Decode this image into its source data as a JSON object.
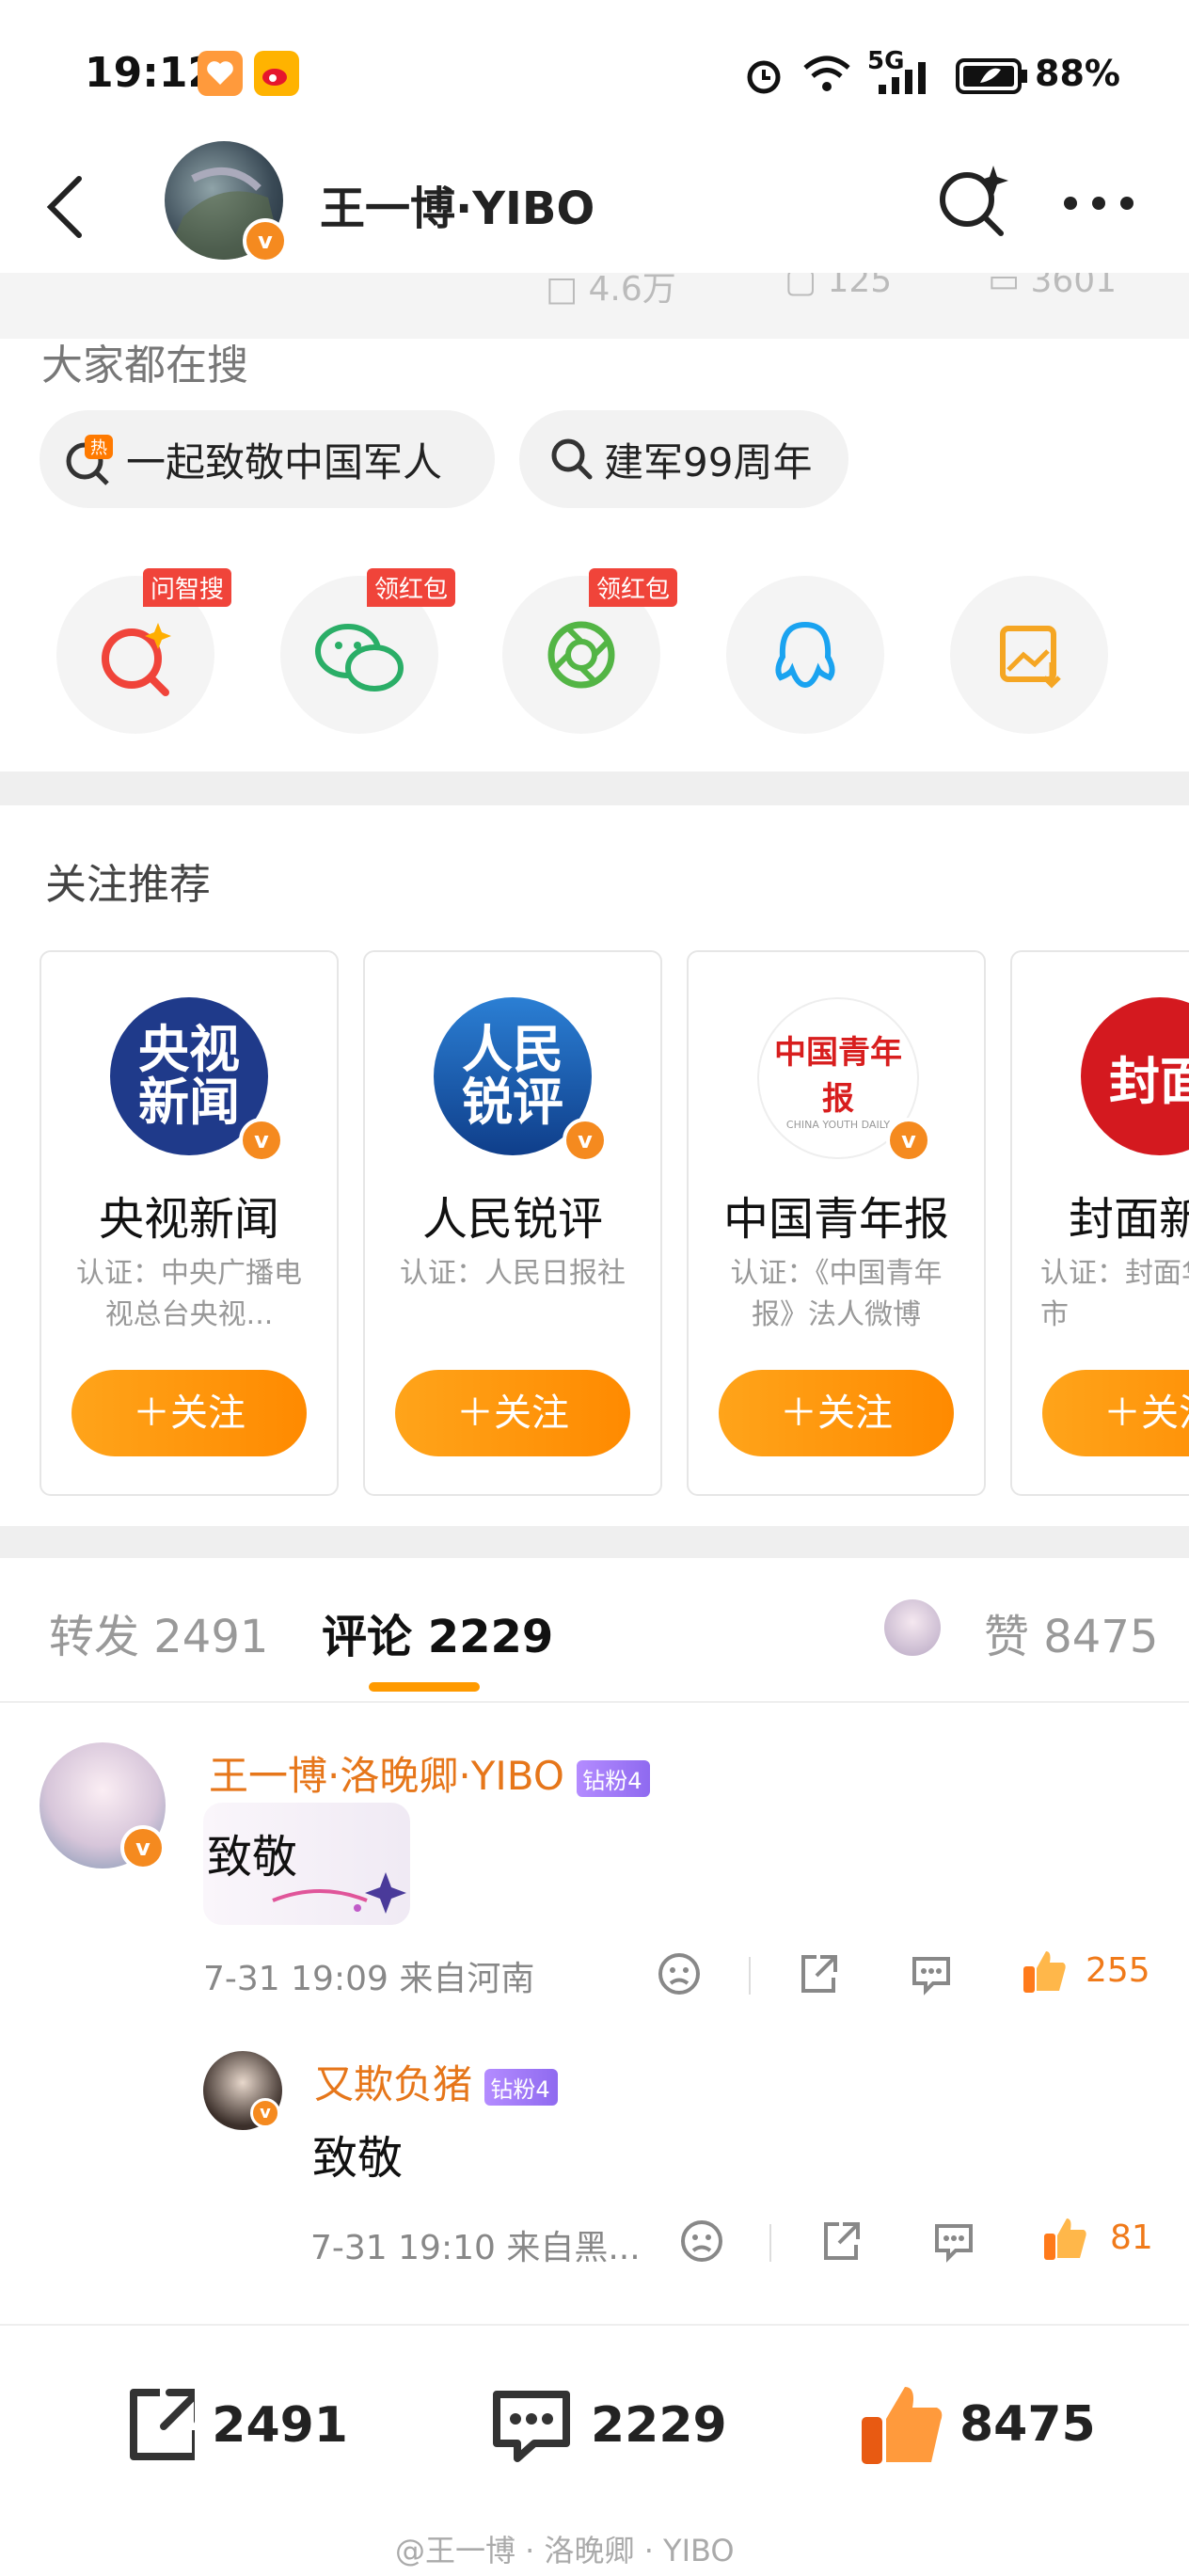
{
  "status_bar": {
    "time": "19:12",
    "network": "5G",
    "battery": "88%"
  },
  "header": {
    "title": "王一博·YIBO"
  },
  "strip": {
    "stats": [
      "4.6万",
      "125",
      "3601"
    ]
  },
  "searches": {
    "label": "大家都在搜",
    "items": [
      "一起致敬中国军人",
      "建军99周年"
    ]
  },
  "shortcuts": [
    {
      "tag": "问智搜",
      "icon": "ai-search-icon"
    },
    {
      "tag": "领红包",
      "icon": "wechat-icon"
    },
    {
      "tag": "领红包",
      "icon": "moments-icon"
    },
    {
      "tag": "",
      "icon": "qq-icon"
    },
    {
      "tag": "",
      "icon": "save-image-icon"
    }
  ],
  "recommend": {
    "label": "关注推荐",
    "follow_label": "＋关注",
    "cards": [
      {
        "name": "央视新闻",
        "desc": "认证：中央广播电视总台央视...",
        "logo": "央视新闻"
      },
      {
        "name": "人民锐评",
        "desc": "认证：人民日报社",
        "logo": "人民锐评"
      },
      {
        "name": "中国青年报",
        "desc": "认证：《中国青年报》法人微博",
        "logo": "中国青年报",
        "logo_sub": "CHINA YOUTH DAILY"
      },
      {
        "name": "封面新",
        "desc": "认证：封面华西都市",
        "logo": "封面"
      }
    ]
  },
  "tabs": {
    "repost": "转发 2491",
    "comments": "评论 2229",
    "likes": "赞 8475"
  },
  "comments": [
    {
      "name": "王一博·洛晚卿·YIBO",
      "badge": "钻粉4",
      "text": "致敬",
      "meta": "7-31 19:09 来自河南",
      "likes": "255"
    },
    {
      "name": "又欺负猪",
      "badge": "钻粉4",
      "text": "致敬",
      "meta": "7-31 19:10 来自黑...",
      "likes": "81"
    }
  ],
  "bottom": {
    "repost": "2491",
    "comment": "2229",
    "like": "8475"
  },
  "watermark": "@王一博 · 洛晚卿 · YIBO",
  "colors": {
    "accent": "#ff8a00",
    "name_orange": "#e6761a",
    "hot_red": "#f0443a"
  }
}
